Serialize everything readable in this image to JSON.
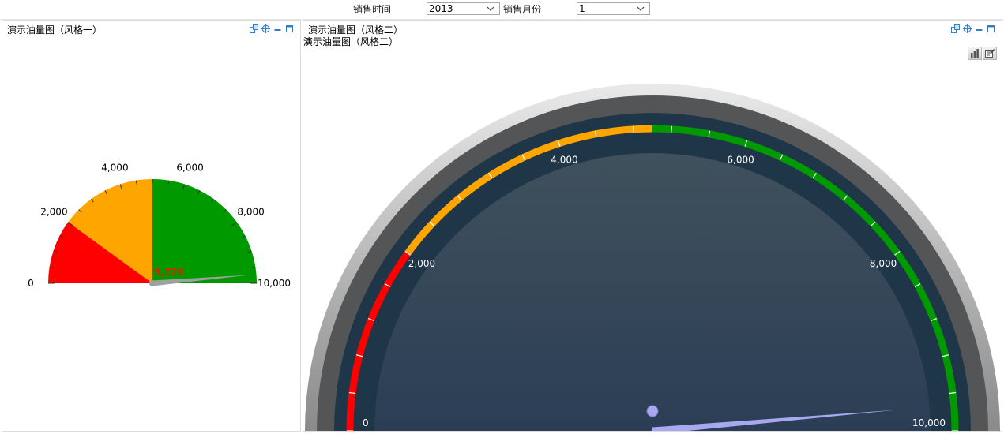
{
  "filters": {
    "sales_time_label": "销售时间",
    "year_value": "2013",
    "sales_month_label": "销售月份",
    "month_value": "1"
  },
  "panel1": {
    "title": "演示油量图（风格一）"
  },
  "panel2": {
    "title": "演示油量图（风格二）",
    "subtitle": "演示油量图（风格二）"
  },
  "icons": [
    "export-icon",
    "crosshair-icon",
    "minimize-icon",
    "maximize-icon",
    "bar-chart-icon",
    "edit-chart-icon"
  ],
  "colors": {
    "red": "#ff0000",
    "orange": "#ffa500",
    "green": "#009a00",
    "needle_gray": "#a0a0a0",
    "needle_lavender": "#a8a8f0",
    "value_label": "#e02000"
  },
  "chart_data": [
    {
      "type": "gauge",
      "name": "style-1",
      "min": 0,
      "max": 10000,
      "value": 9728,
      "value_label": "9,728",
      "bands": [
        {
          "from": 0,
          "to": 2000,
          "color": "#ff0000"
        },
        {
          "from": 2000,
          "to": 5000,
          "color": "#ffa500"
        },
        {
          "from": 5000,
          "to": 10000,
          "color": "#009a00"
        }
      ],
      "tick_labels": [
        {
          "value": 0,
          "label": "0"
        },
        {
          "value": 2000,
          "label": "2,000"
        },
        {
          "value": 4000,
          "label": "4,000"
        },
        {
          "value": 6000,
          "label": "6,000"
        },
        {
          "value": 8000,
          "label": "8,000"
        },
        {
          "value": 10000,
          "label": "10,000"
        }
      ]
    },
    {
      "type": "gauge",
      "name": "style-2",
      "min": 0,
      "max": 10000,
      "value": 9728,
      "bands": [
        {
          "from": 0,
          "to": 2000,
          "color": "#ff0000"
        },
        {
          "from": 2000,
          "to": 5000,
          "color": "#ffa500"
        },
        {
          "from": 5000,
          "to": 10000,
          "color": "#009a00"
        }
      ],
      "tick_labels": [
        {
          "value": 0,
          "label": "0"
        },
        {
          "value": 2000,
          "label": "2,000"
        },
        {
          "value": 4000,
          "label": "4,000"
        },
        {
          "value": 6000,
          "label": "6,000"
        },
        {
          "value": 8000,
          "label": "8,000"
        },
        {
          "value": 10000,
          "label": "10,000"
        }
      ]
    }
  ]
}
